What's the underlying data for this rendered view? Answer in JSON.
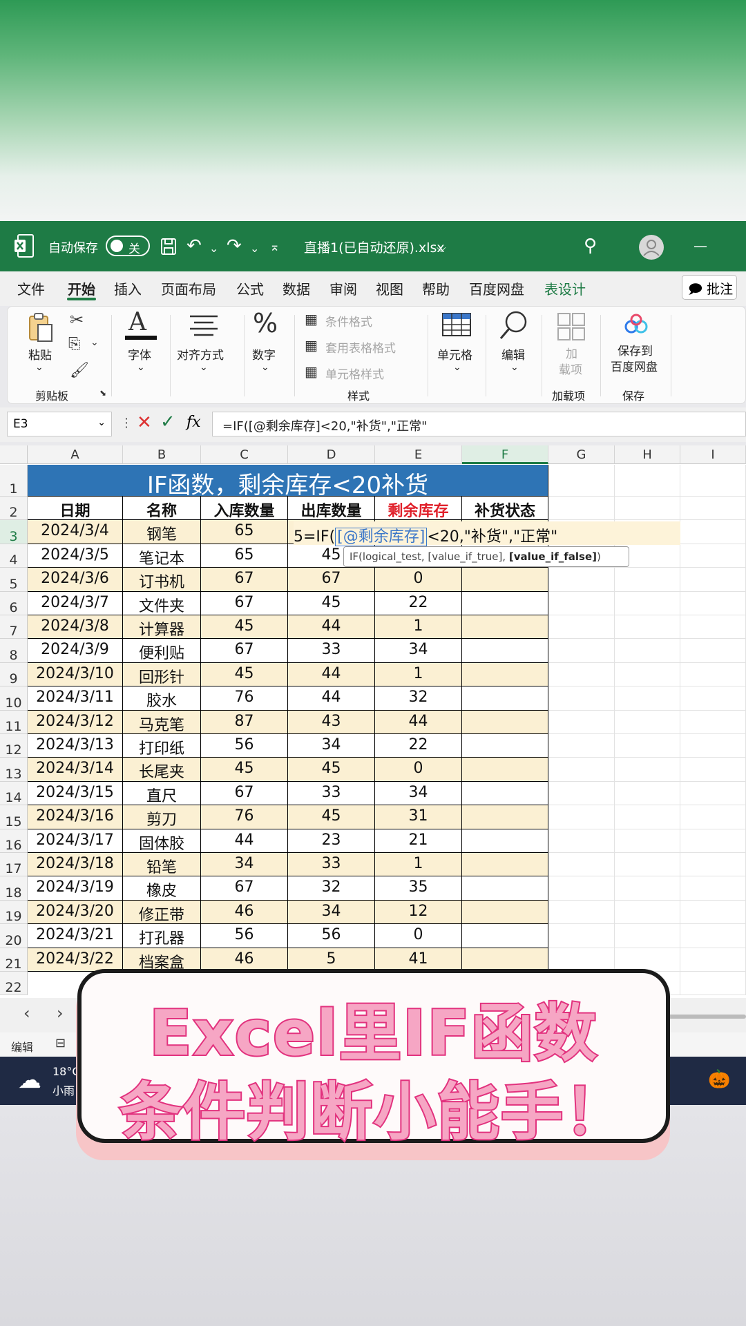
{
  "titlebar": {
    "autosave_label": "自动保存",
    "toggle_label": "关",
    "filename": "直播1(已自动还原).xlsx",
    "chevron": "⌵",
    "search_icon": "⚲",
    "minimize": "—"
  },
  "menu": {
    "items": [
      "文件",
      "开始",
      "插入",
      "页面布局",
      "公式",
      "数据",
      "审阅",
      "视图",
      "帮助",
      "百度网盘",
      "表设计"
    ],
    "comment_label": "批注"
  },
  "ribbon": {
    "paste": "粘贴",
    "clipboard": "剪贴板",
    "font": "字体",
    "align": "对齐方式",
    "number": "数字",
    "cond_format": "条件格式",
    "table_format": "套用表格格式",
    "cell_style": "单元格样式",
    "styles": "样式",
    "cells": "单元格",
    "edit": "编辑",
    "addin_top": "加",
    "addin_bottom": "载项",
    "addins": "加载项",
    "save_to_line1": "保存到",
    "save_to_line2": "百度网盘",
    "save": "保存"
  },
  "formula": {
    "namebox": "E3",
    "fx": "fx",
    "content": "=IF([@剩余库存]<20,\"补货\",\"正常\""
  },
  "columns": [
    "A",
    "B",
    "C",
    "D",
    "E",
    "F",
    "G",
    "H",
    "I"
  ],
  "table": {
    "title": "IF函数，剩余库存<20补货",
    "headers": [
      "日期",
      "名称",
      "入库数量",
      "出库数量",
      "剩余库存",
      "补货状态"
    ],
    "rows": [
      [
        "2024/3/4",
        "钢笔",
        "65",
        "",
        "",
        ""
      ],
      [
        "2024/3/5",
        "笔记本",
        "65",
        "45",
        "",
        ""
      ],
      [
        "2024/3/6",
        "订书机",
        "67",
        "67",
        "0",
        ""
      ],
      [
        "2024/3/7",
        "文件夹",
        "67",
        "45",
        "22",
        ""
      ],
      [
        "2024/3/8",
        "计算器",
        "45",
        "44",
        "1",
        ""
      ],
      [
        "2024/3/9",
        "便利贴",
        "67",
        "33",
        "34",
        ""
      ],
      [
        "2024/3/10",
        "回形针",
        "45",
        "44",
        "1",
        ""
      ],
      [
        "2024/3/11",
        "胶水",
        "76",
        "44",
        "32",
        ""
      ],
      [
        "2024/3/12",
        "马克笔",
        "87",
        "43",
        "44",
        ""
      ],
      [
        "2024/3/13",
        "打印纸",
        "56",
        "34",
        "22",
        ""
      ],
      [
        "2024/3/14",
        "长尾夹",
        "45",
        "45",
        "0",
        ""
      ],
      [
        "2024/3/15",
        "直尺",
        "67",
        "33",
        "34",
        ""
      ],
      [
        "2024/3/16",
        "剪刀",
        "76",
        "45",
        "31",
        ""
      ],
      [
        "2024/3/17",
        "固体胶",
        "44",
        "23",
        "21",
        ""
      ],
      [
        "2024/3/18",
        "铅笔",
        "34",
        "33",
        "1",
        ""
      ],
      [
        "2024/3/19",
        "橡皮",
        "67",
        "32",
        "35",
        ""
      ],
      [
        "2024/3/20",
        "修正带",
        "46",
        "34",
        "12",
        ""
      ],
      [
        "2024/3/21",
        "打孔器",
        "56",
        "56",
        "0",
        ""
      ],
      [
        "2024/3/22",
        "档案盒",
        "46",
        "5",
        "41",
        ""
      ]
    ],
    "edit_prefix": "5=IF(",
    "edit_ref": "[@剩余库存]",
    "edit_suffix": "<20,\"补货\",\"正常\"",
    "tooltip_plain": "IF(logical_test, [value_if_true], ",
    "tooltip_bold": "[value_if_false]",
    "tooltip_close": ")"
  },
  "statusbar": {
    "mode": "编辑"
  },
  "taskbar": {
    "temp": "18°C",
    "weather": "小雨"
  },
  "overlay": {
    "line1": "Excel里IF函数",
    "line2": "条件判断小能手！"
  },
  "colors": {
    "excel_green": "#1e7b45",
    "title_blue": "#2e74b5",
    "band": "#fbf0d3",
    "overlay_pink": "#e2327e",
    "header_red": "#e0202a"
  }
}
